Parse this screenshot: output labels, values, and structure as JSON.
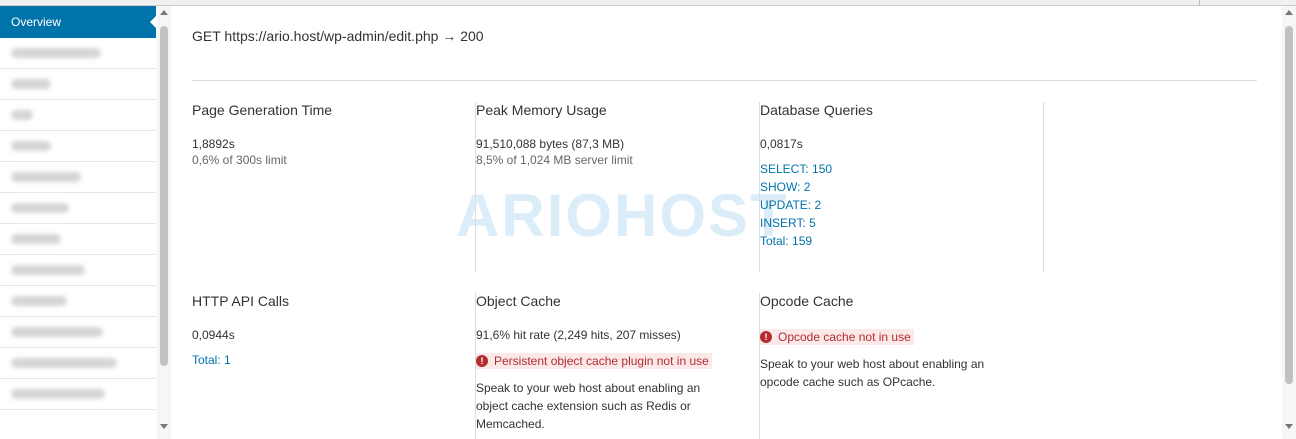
{
  "sidebar": {
    "active_label": "Overview",
    "blurred_item_count": 13
  },
  "request": {
    "label": "GET https://ario.host/wp-admin/edit.php → 200"
  },
  "watermark": {
    "text": "ARIOHOST"
  },
  "panels": {
    "page_generation": {
      "title": "Page Generation Time",
      "value": "1,8892s",
      "sub": "0,6% of 300s limit"
    },
    "peak_memory": {
      "title": "Peak Memory Usage",
      "value": "91,510,088 bytes (87,3 MB)",
      "sub": "8,5% of 1,024 MB server limit"
    },
    "database_queries": {
      "title": "Database Queries",
      "value": "0,0817s",
      "links": [
        "SELECT: 150",
        "SHOW: 2",
        "UPDATE: 2",
        "INSERT: 5",
        "Total: 159"
      ]
    },
    "http_api": {
      "title": "HTTP API Calls",
      "value": "0,0944s",
      "link": "Total: 1"
    },
    "object_cache": {
      "title": "Object Cache",
      "value": "91,6% hit rate (2,249 hits, 207 misses)",
      "warning": "Persistent object cache plugin not in use",
      "desc": "Speak to your web host about enabling an object cache extension such as Redis or Memcached."
    },
    "opcode_cache": {
      "title": "Opcode Cache",
      "warning": "Opcode cache not in use",
      "desc": "Speak to your web host about enabling an opcode cache such as OPcache."
    }
  },
  "colors": {
    "accent": "#0073aa",
    "warning": "#b32d2e",
    "warning_bg": "#fbe9ea"
  }
}
